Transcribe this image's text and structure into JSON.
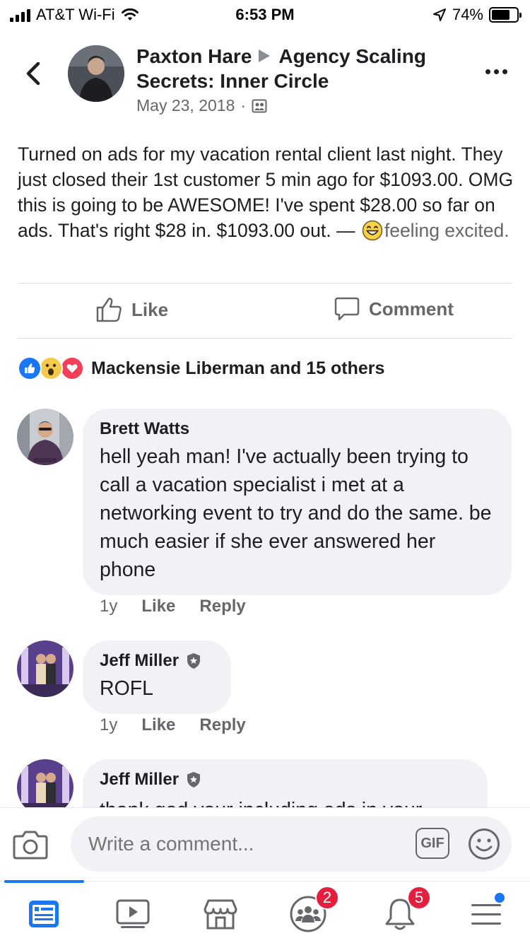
{
  "status_bar": {
    "carrier": "AT&T Wi-Fi",
    "time": "6:53 PM",
    "battery_pct": "74%",
    "battery_level": 0.74
  },
  "post": {
    "author": "Paxton Hare",
    "group": "Agency Scaling Secrets: Inner Circle",
    "date": "May 23, 2018",
    "separator": "·",
    "body": "Turned on ads for my vacation rental client last night. They just closed their 1st customer 5 min ago for $1093.00. OMG this is going to be AWESOME! I've spent $28.00 so far on ads.  That's right $28 in. $1093.00 out. —",
    "feeling": "feeling excited.",
    "like_label": "Like",
    "comment_label": "Comment",
    "reactions_summary": "Mackensie Liberman and 15 others",
    "reaction_icons": [
      "like-reaction-icon",
      "wow-reaction-icon",
      "love-reaction-icon"
    ]
  },
  "comments": [
    {
      "name": "Brett Watts",
      "text": "hell yeah man! I've actually been trying to call a vacation specialist i met at a networking event to try and do the same. be much easier if she ever answered her phone",
      "time": "1y",
      "like": "Like",
      "reply": "Reply"
    },
    {
      "name": "Jeff Miller",
      "text": "ROFL",
      "time": "1y",
      "like": "Like",
      "reply": "Reply"
    },
    {
      "name": "Jeff Miller",
      "text": "thank god your including ads in your"
    }
  ],
  "composer": {
    "placeholder": "Write a comment...",
    "gif_label": "GIF"
  },
  "tabbar": {
    "groups_badge": "2",
    "notifications_badge": "5"
  },
  "colors": {
    "accent": "#1877f2",
    "badge": "#e41e3f",
    "bubble": "#f0f2f5",
    "secondary_text": "#65676b"
  }
}
